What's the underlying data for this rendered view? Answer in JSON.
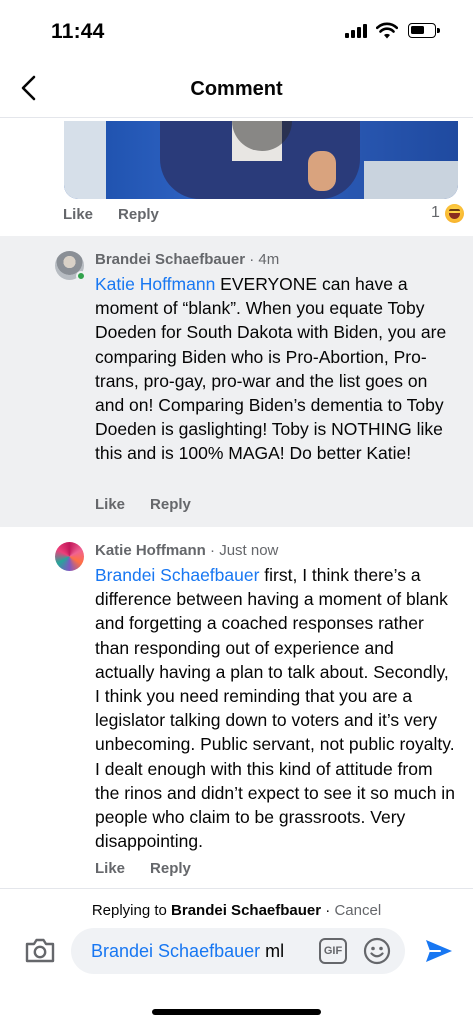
{
  "status_bar": {
    "time": "11:44"
  },
  "header": {
    "title": "Comment"
  },
  "top_comment_actions": {
    "like": "Like",
    "reply": "Reply",
    "reaction_count": "1"
  },
  "comments": [
    {
      "author": "Brandei Schaefbauer",
      "time": "4m",
      "mention": "Katie Hoffmann",
      "text": " EVERYONE can have a moment of “blank”. When you equate Toby Doeden for South Dakota with Biden, you are comparing Biden who is Pro-Abortion, Pro-trans, pro-gay, pro-war and the list goes on and on! Comparing Biden’s dementia to Toby Doeden is gaslighting! Toby is NOTHING like this and is 100% MAGA! Do better Katie!",
      "like": "Like",
      "reply": "Reply"
    },
    {
      "author": "Katie Hoffmann",
      "time": "Just now",
      "mention": "Brandei Schaefbauer",
      "text": " first, I think there’s a difference between having a moment of blank and forgetting a coached responses rather than responding out of experience and actually having a plan to talk about. Secondly, I think you need reminding that you are a legislator talking down to voters and it’s very unbecoming. Public servant, not public royalty. I dealt enough with this kind of attitude from the rinos and didn’t expect to see it so much in people who claim to be grassroots. Very disappointing.",
      "like": "Like",
      "reply": "Reply"
    }
  ],
  "reply_bar": {
    "replying_prefix": "Replying to ",
    "replying_name": "Brandei Schaefbauer",
    "separator": " · ",
    "cancel": "Cancel",
    "input_mention": "Brandei Schaefbauer",
    "input_typed": " ml",
    "gif_label": "GIF"
  },
  "colors": {
    "link_blue": "#1877f2",
    "secondary_text": "#65676b",
    "highlight_bg": "#eff0f2",
    "send_blue": "#1877f2",
    "online_green": "#31a24c"
  },
  "icons": [
    "back-arrow-icon",
    "signal-icon",
    "wifi-icon",
    "battery-icon",
    "haha-reaction-icon",
    "camera-icon",
    "gif-icon",
    "emoji-icon",
    "send-icon"
  ]
}
